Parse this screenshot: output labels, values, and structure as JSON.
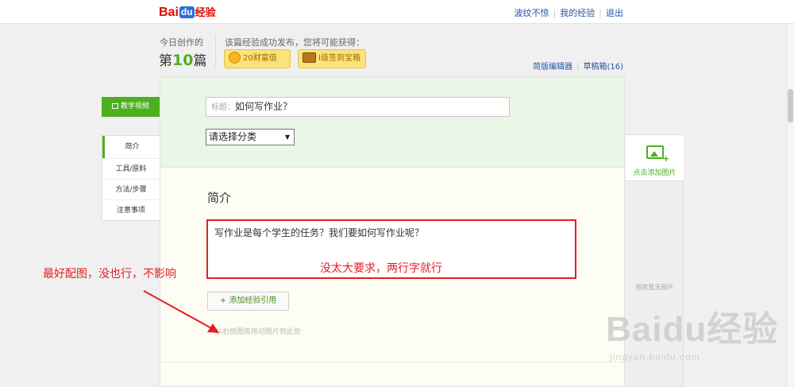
{
  "header": {
    "logo": {
      "bai": "Bai",
      "du": "du",
      "jingyan": "经验"
    },
    "user_name": "波纹不惊",
    "my_experience": "我的经验",
    "logout": "退出"
  },
  "stats": {
    "today_label": "今日创作的",
    "count_prefix": "第",
    "count_number": "10",
    "count_suffix": "篇",
    "reward_label": "该篇经验成功发布，您将可能获得：",
    "reward_wealth": "20财富值",
    "reward_chest": "I级签到宝箱"
  },
  "editor_links": {
    "simple_editor": "简版编辑器",
    "drafts": "草稿箱(16)"
  },
  "video_button": "教学视频",
  "sidebar": {
    "items": [
      {
        "label": "简介"
      },
      {
        "label": "工具/原料"
      },
      {
        "label": "方法/步骤"
      },
      {
        "label": "注意事项"
      }
    ]
  },
  "form": {
    "title_prefix": "标题：",
    "title_value": "如何写作业？",
    "category_value": "请选择分类",
    "category_arrow": "▼",
    "intro_heading": "简介",
    "intro_text": "写作业是每个学生的任务？我们要如何写作业呢？",
    "intro_note": "没太大要求，两行字就行",
    "add_reference": "+ 添加经验引用",
    "drag_hint": "从右侧图库拖动图片到此处"
  },
  "right_panel": {
    "add_image": "点击添加图片",
    "no_image": "图库暂无图片"
  },
  "annotation": "最好配图，没也行，不影响",
  "watermark": {
    "main": "Baidu经验",
    "sub": "jingyan.baidu.com"
  },
  "colors": {
    "accent_green": "#4caf1f",
    "annotation_red": "#e31e24",
    "link_blue": "#2454a8"
  }
}
